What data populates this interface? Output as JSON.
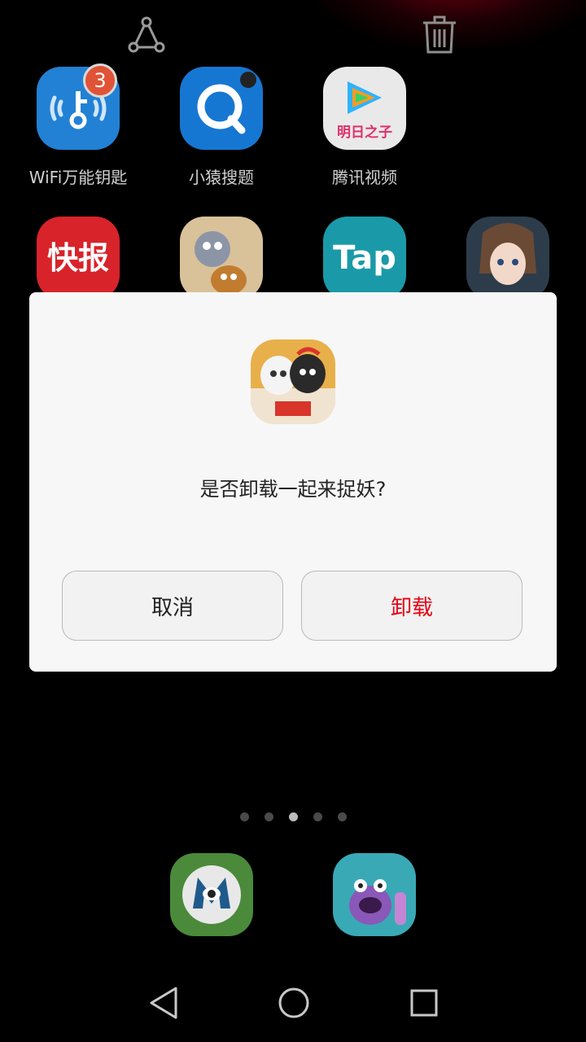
{
  "top_actions": {
    "share_icon": "share-icon",
    "trash_icon": "trash-icon"
  },
  "home_apps_row1": [
    {
      "label": "WiFi万能钥匙",
      "badge": "3"
    },
    {
      "label": "小猿搜题"
    },
    {
      "label": "腾讯视频",
      "icon_text": "明日之子"
    }
  ],
  "home_apps_row2": [
    {
      "icon_text": "快报"
    },
    {
      "icon_text": ""
    },
    {
      "icon_text": "Tap"
    },
    {
      "icon_text": ""
    }
  ],
  "dialog": {
    "message": "是否卸载一起来捉妖?",
    "cancel_label": "取消",
    "uninstall_label": "卸载"
  },
  "page_indicator": {
    "pages": 5,
    "current": 3
  },
  "colors": {
    "uninstall": "#e60012",
    "badge": "#e05336"
  }
}
